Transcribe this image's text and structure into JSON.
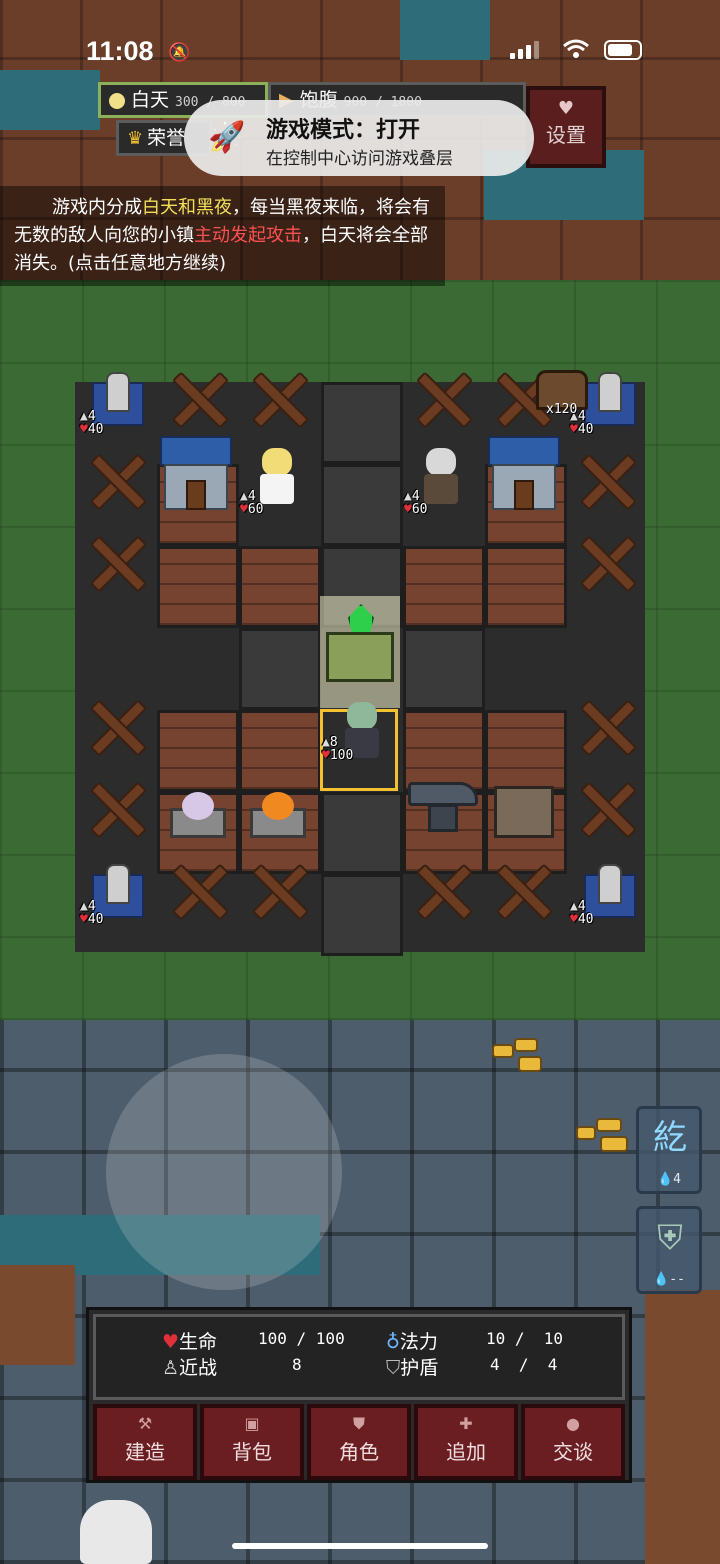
{
  "status_bar": {
    "time": "11:08"
  },
  "hud": {
    "day_label": "白天",
    "day_progress": "300 / 800",
    "food_label": "饱腹",
    "food_value": "900 / 1800",
    "honor_label": "荣誉",
    "settings_label": "设置"
  },
  "toast": {
    "title": "游戏模式：打开",
    "subtitle": "在控制中心访问游戏叠层"
  },
  "tutorial": {
    "part1": "游戏内分成",
    "highlight1": "白天和黑夜",
    "part2": "，每当黑夜来临，将会有无数的敌人向您的小镇",
    "highlight2": "主动发起攻击",
    "part3": "，白天将会全部消失。(点击任意地方继续)"
  },
  "units": {
    "tower_tl": {
      "atk": "4",
      "hp": "40"
    },
    "tower_tr": {
      "atk": "4",
      "hp": "40"
    },
    "tower_bl": {
      "atk": "4",
      "hp": "40"
    },
    "tower_br": {
      "atk": "4",
      "hp": "40"
    },
    "angel": {
      "atk": "4",
      "hp": "60"
    },
    "elder": {
      "atk": "4",
      "hp": "60"
    },
    "hero": {
      "atk": "8",
      "hp": "100"
    },
    "chest_count": "x120"
  },
  "skills": [
    {
      "glyph": "紇",
      "count": "4"
    },
    {
      "glyph": "⛨",
      "count": "--"
    }
  ],
  "stats": {
    "hp_label": "生命",
    "hp_value": "100 / 100",
    "mp_label": "法力",
    "mp_value": "10 /  10",
    "melee_label": "近战",
    "melee_value": "8",
    "shield_label": "护盾",
    "shield_value": "4  /  4"
  },
  "actions": [
    {
      "label": "建造"
    },
    {
      "label": "背包"
    },
    {
      "label": "角色"
    },
    {
      "label": "追加"
    },
    {
      "label": "交谈"
    }
  ],
  "colors": {
    "accent_gold": "#f2c230",
    "button_red": "#6a1e22",
    "highlight_yellow": "#f2e05a",
    "highlight_red": "#ff5050"
  }
}
